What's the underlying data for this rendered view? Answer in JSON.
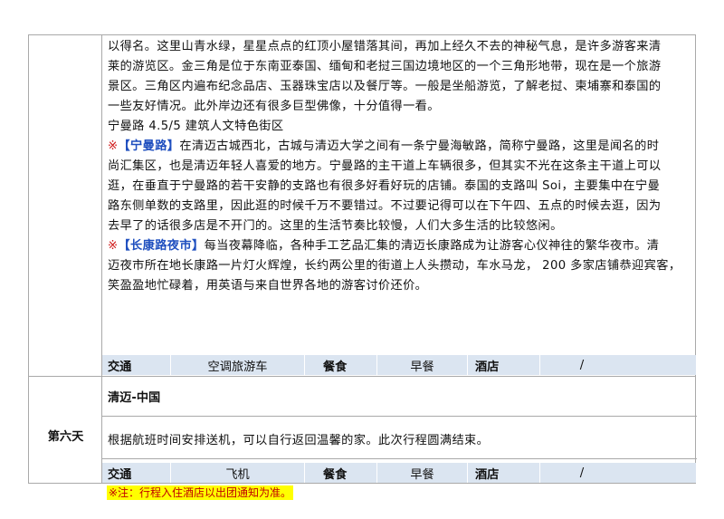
{
  "paragraphs": {
    "p1_lines": [
      "以得名。这里山青水绿，星星点点的红顶小屋错落其间，再加上经久不去的神秘气息，是许多游客来清",
      "莱的游览区。金三角是位于东南亚泰国、缅甸和老挝三国边境地区的一个三角形地带，现在是一个旅游",
      "景区。三角区内遍布纪念品店、玉器珠宝店以及餐厅等。一般是坐船游览，了解老挝、柬埔寨和泰国的",
      "一些友好情况。此外岸边还有很多巨型佛像，十分值得一看。"
    ],
    "rating_line": "宁曼路 4.5/5 建筑人文特色街区",
    "nimman": {
      "mark": "※",
      "name": "【宁曼路】",
      "first": "在清迈古城西北，古城与清迈大学之间有一条宁曼海敏路，简称宁曼路，这里是闻名的时",
      "lines": [
        "尚汇集区，也是清迈年轻人喜爱的地方。宁曼路的主干道上车辆很多，但其实不光在这条主干道上可以",
        "逛，在垂直于宁曼路的若干安静的支路也有很多好看好玩的店铺。泰国的支路叫 Soi，主要集中在宁曼",
        "路东侧单数的支路里，因此逛的时候千万不要错过。不过要记得可以在下午四、五点的时候去逛，因为",
        "去早了的话很多店是不开门的。这里的生活节奏比较慢，人们大多生活的比较悠闲。"
      ]
    },
    "market": {
      "mark": "※",
      "name": "【长康路夜市】",
      "first": "每当夜幕降临，各种手工艺品汇集的清迈长康路成为让游客心仪神往的繁华夜市。清",
      "lines": [
        "迈夜市所在地长康路一片灯火辉煌，长约两公里的街道上人头攒动，车水马龙， 200 多家店铺恭迎宾客，",
        "笑盈盈地忙碌着，用英语与来自世界各地的游客讨价还价。"
      ]
    }
  },
  "row1": {
    "transport_label": "交通",
    "transport_value": "空调旅游车",
    "meal_label": "餐食",
    "meal_value": "早餐",
    "hotel_label": "酒店",
    "hotel_value": "/"
  },
  "day6": {
    "label": "第六天",
    "title": "清迈-中国",
    "text": "根据航班时间安排送机，可以自行返回温馨的家。此次行程圆满结束。"
  },
  "row2": {
    "transport_label": "交通",
    "transport_value": "飞机",
    "meal_label": "餐食",
    "meal_value": "早餐",
    "hotel_label": "酒店",
    "hotel_value": "/"
  },
  "note": "※注：行程入住酒店以出团通知为准。",
  "colors": {
    "row_bg": "#dbe5f1",
    "note_bg": "#ffff00",
    "highlight": "#1f4fbf",
    "mark": "#d01818"
  }
}
